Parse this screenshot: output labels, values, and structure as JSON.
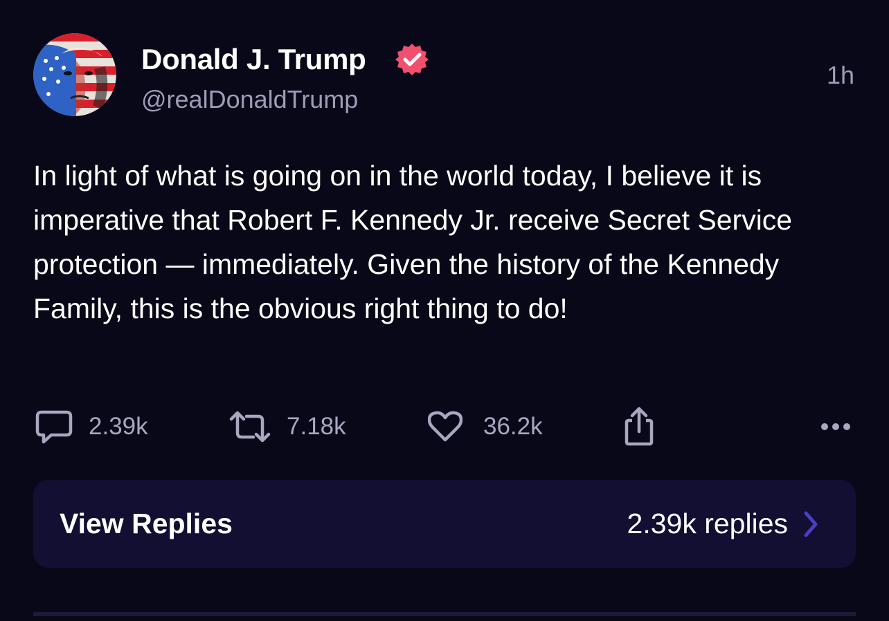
{
  "post": {
    "author_name": "Donald J. Trump",
    "handle": "@realDonaldTrump",
    "timestamp": "1h",
    "body": "In light of what is going on in the world today, I believe it is imperative that Robert F. Kennedy Jr. receive Secret Service protection — immediately. Given the history of the Kennedy Family, this is the obvious right thing to do!"
  },
  "actions": {
    "replies": "2.39k",
    "reposts": "7.18k",
    "likes": "36.2k"
  },
  "icons": {
    "verified": "verified-badge-icon",
    "reply": "comment-bubble-icon",
    "repost": "repost-arrows-icon",
    "like": "heart-icon",
    "share": "share-icon",
    "more": "more-dots-icon",
    "chevron": "chevron-right-icon"
  },
  "replies_card": {
    "label": "View Replies",
    "count_text": "2.39k replies"
  },
  "colors": {
    "background": "#090818",
    "card": "#120f33",
    "verified": "#f0506e",
    "muted_text": "#9e9cb6",
    "chevron": "#4a3fc0"
  }
}
